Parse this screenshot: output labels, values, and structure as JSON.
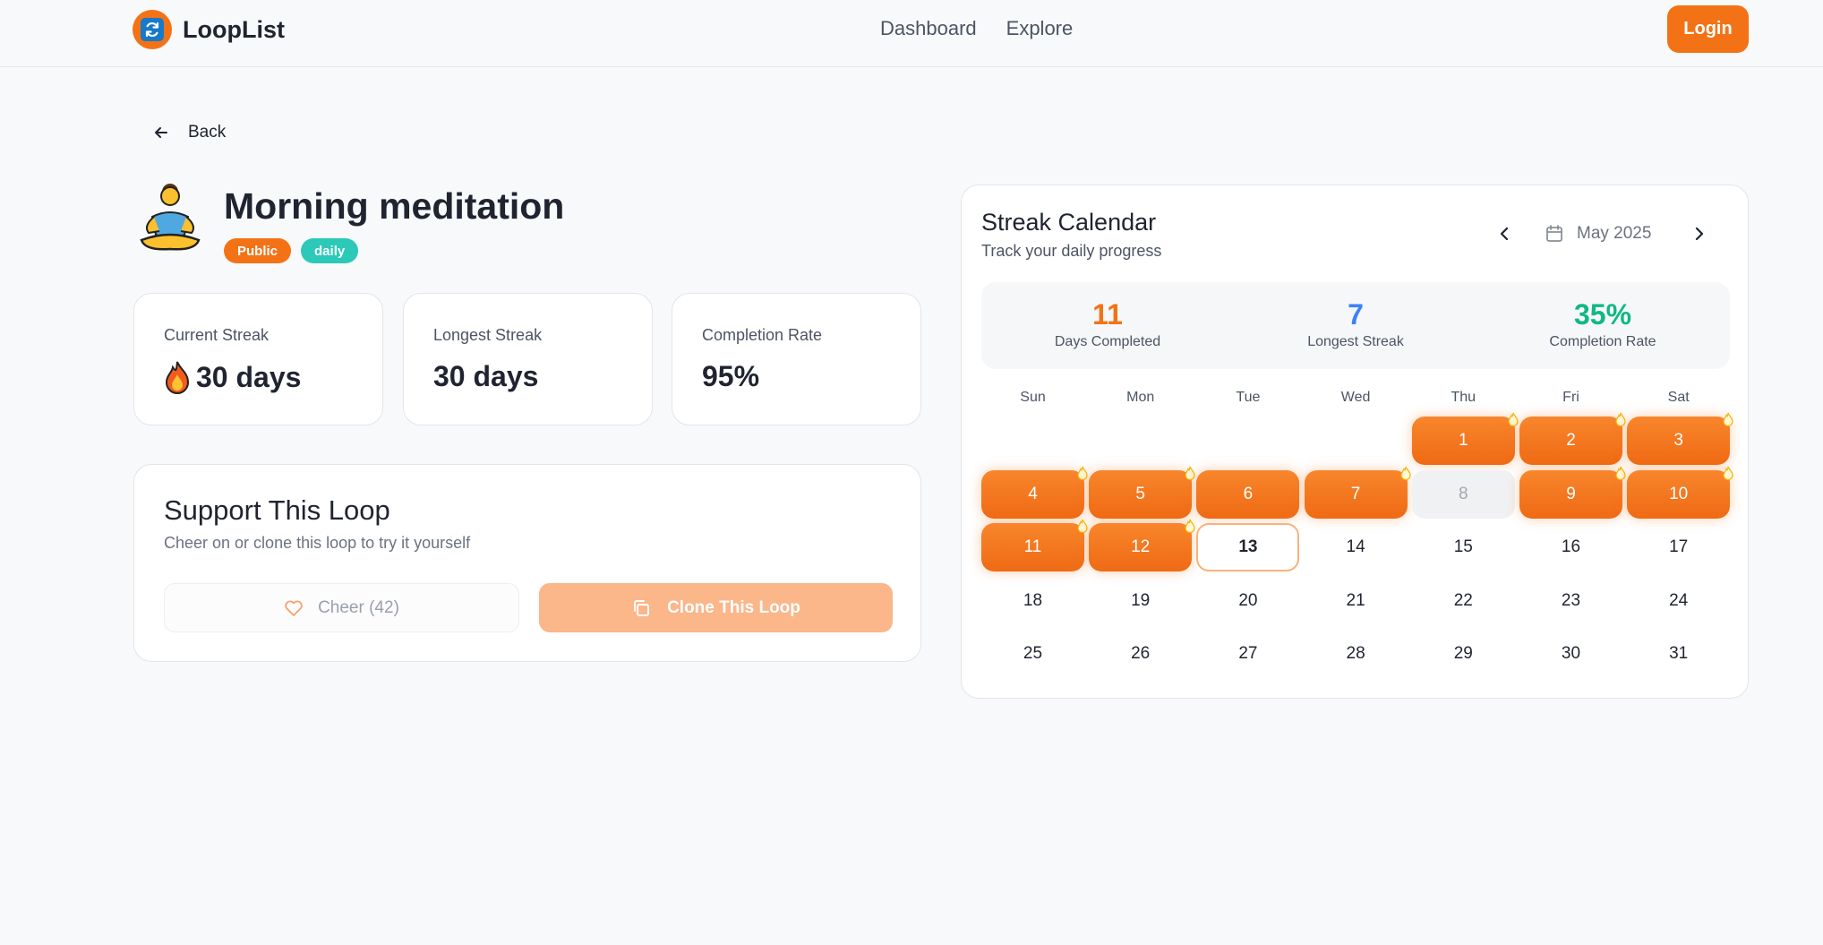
{
  "header": {
    "brand": "LoopList",
    "nav": [
      "Dashboard",
      "Explore"
    ],
    "login_label": "Login"
  },
  "back_label": "Back",
  "loop": {
    "icon": "person-in-lotus-position-emoji",
    "title": "Morning meditation",
    "badges": [
      "Public",
      "daily"
    ]
  },
  "stats": [
    {
      "label": "Current Streak",
      "value": "30 days",
      "icon": "fire-emoji"
    },
    {
      "label": "Longest Streak",
      "value": "30 days"
    },
    {
      "label": "Completion Rate",
      "value": "95%"
    }
  ],
  "support": {
    "title": "Support This Loop",
    "subtitle": "Cheer on or clone this loop to try it yourself",
    "cheer_label": "Cheer (42)",
    "clone_label": "Clone This Loop"
  },
  "calendar": {
    "title": "Streak Calendar",
    "subtitle": "Track your daily progress",
    "month_label": "May 2025",
    "summary": [
      {
        "value": "11",
        "caption": "Days Completed",
        "color": "#f47216"
      },
      {
        "value": "7",
        "caption": "Longest Streak",
        "color": "#3b82f6"
      },
      {
        "value": "35%",
        "caption": "Completion Rate",
        "color": "#10b981"
      }
    ],
    "weekdays": [
      "Sun",
      "Mon",
      "Tue",
      "Wed",
      "Thu",
      "Fri",
      "Sat"
    ],
    "first_weekday_index": 4,
    "days_in_month": 31,
    "completed_days": [
      1,
      2,
      3,
      4,
      5,
      6,
      7,
      9,
      10,
      11,
      12
    ],
    "missed_days": [
      8
    ],
    "today": 13,
    "flame_days": [
      1,
      2,
      3,
      4,
      5,
      7,
      9,
      10,
      11,
      12
    ]
  },
  "colors": {
    "accent": "#f47216",
    "teal": "#2cc9b8"
  }
}
